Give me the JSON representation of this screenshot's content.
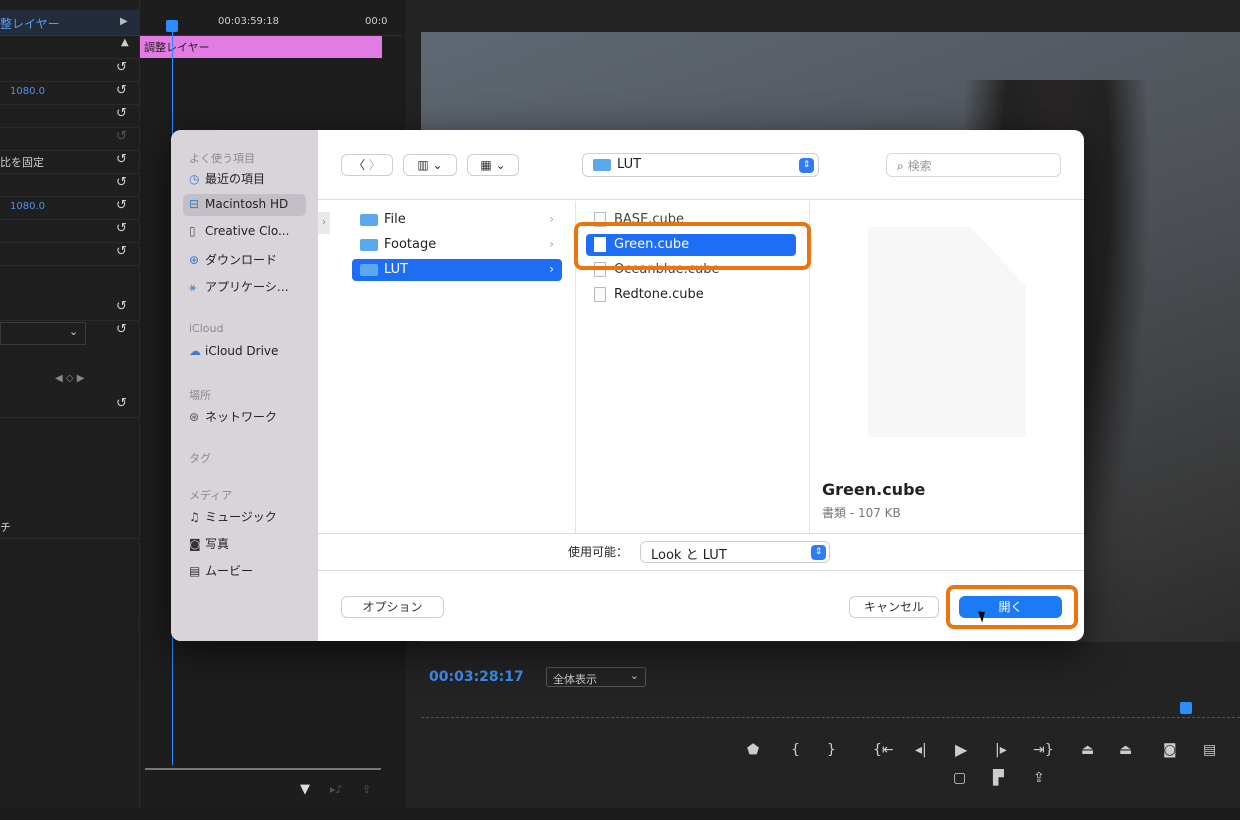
{
  "effect_controls": {
    "header_label": "整レイヤー",
    "values": [
      "1080.0",
      "1080.0"
    ],
    "labels": [
      "比を固定",
      "チ"
    ],
    "reset_icon": "↺"
  },
  "timeline": {
    "time_a": "00:03:59:18",
    "time_b": "00:0",
    "clip_label": "調整レイヤー"
  },
  "program": {
    "timecode": "00:03:28:17",
    "fit": "全体表示"
  },
  "dialog": {
    "path_label": "LUT",
    "search_placeholder": "検索",
    "sidebar": {
      "favorites_header": "よく使う項目",
      "icloud_header": "iCloud",
      "places_header": "場所",
      "tags_header": "タグ",
      "media_header": "メディア",
      "items": {
        "recents": "最近の項目",
        "macintosh": "Macintosh HD",
        "creative": "Creative Clo...",
        "downloads": "ダウンロード",
        "applications": "アプリケーシ…",
        "icloud_drive": "iCloud Drive",
        "network": "ネットワーク",
        "music": "ミュージック",
        "photos": "写真",
        "movies": "ムービー"
      }
    },
    "folders": [
      "File",
      "Footage",
      "LUT"
    ],
    "files": [
      "BASE.cube",
      "Green.cube",
      "Oceanblue.cube",
      "Redtone.cube"
    ],
    "preview": {
      "name": "Green.cube",
      "meta": "書類 - 107 KB"
    },
    "formats_label": "使用可能：",
    "formats_value": "Look と LUT",
    "options_button": "オプション",
    "cancel_button": "キャンセル",
    "open_button": "開く"
  },
  "colors": {
    "accent": "#1d6ef5",
    "highlight": "#e8750f",
    "clip": "#e27be3"
  }
}
